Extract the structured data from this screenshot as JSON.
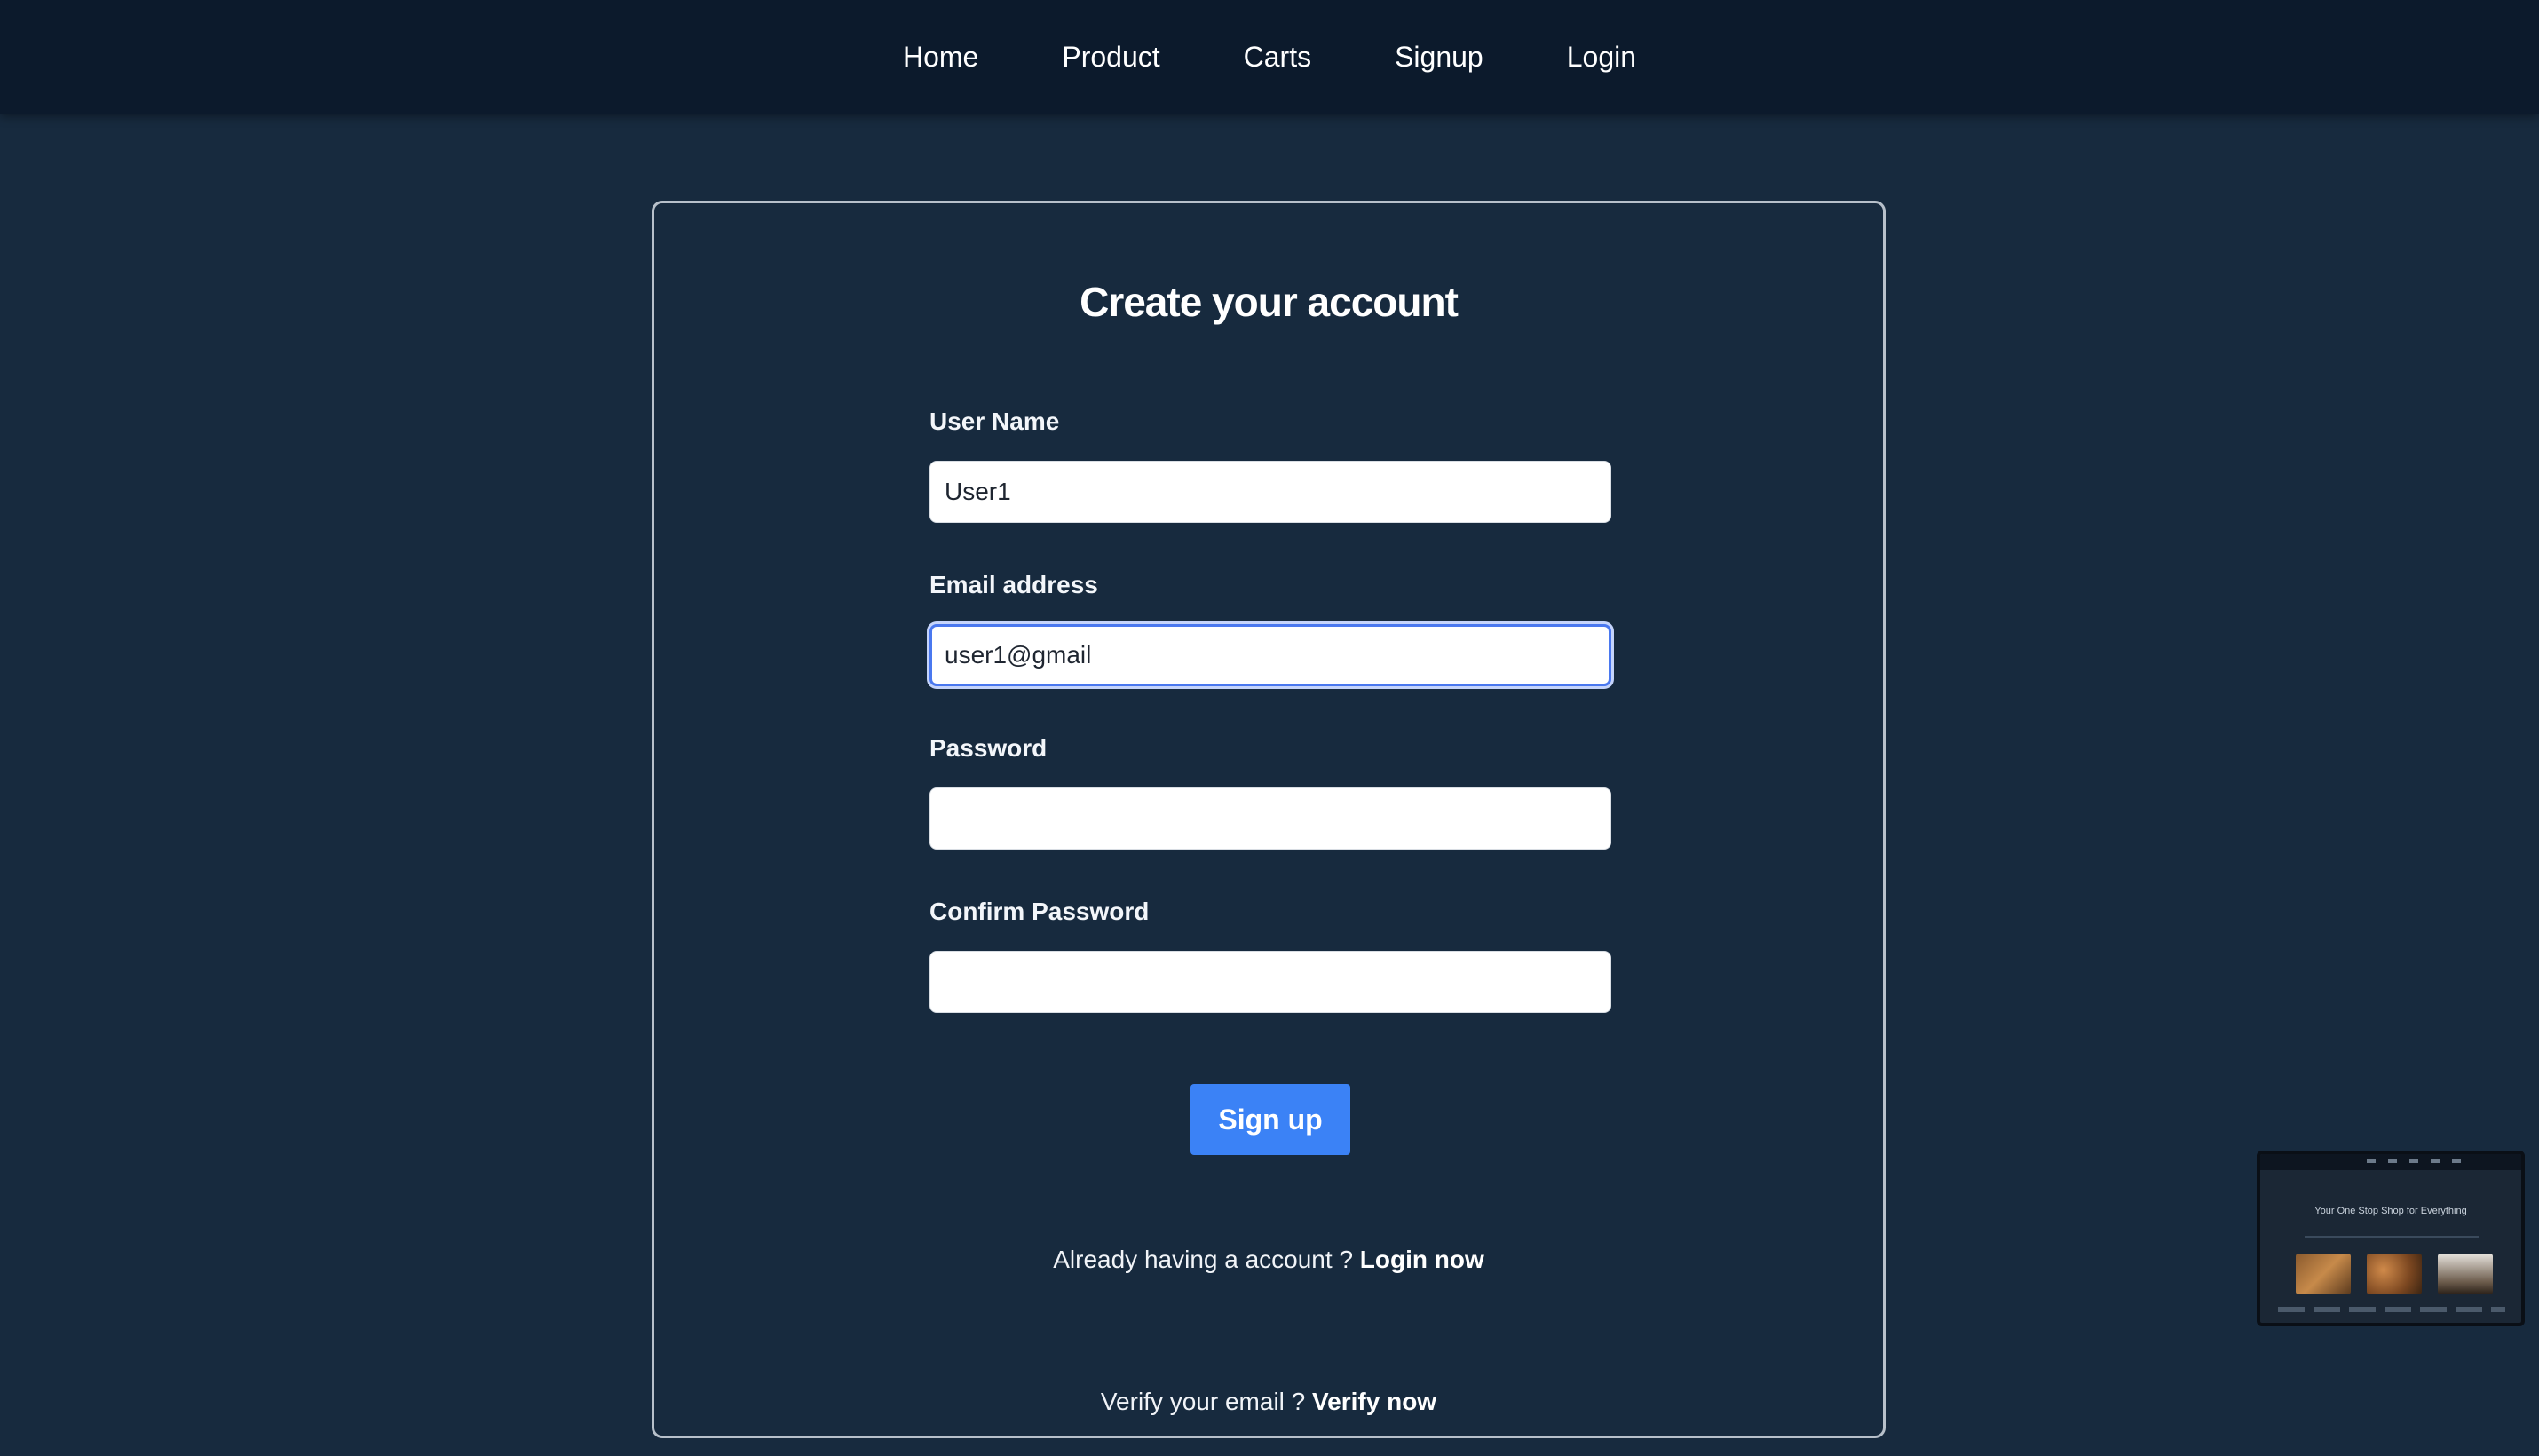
{
  "nav": {
    "items": [
      {
        "label": "Home"
      },
      {
        "label": "Product"
      },
      {
        "label": "Carts"
      },
      {
        "label": "Signup"
      },
      {
        "label": "Login"
      }
    ]
  },
  "form": {
    "title": "Create your account",
    "fields": {
      "username": {
        "label": "User Name",
        "value": "User1"
      },
      "email": {
        "label": "Email address",
        "value": "user1@gmail"
      },
      "password": {
        "label": "Password",
        "value": ""
      },
      "confirm_password": {
        "label": "Confirm Password",
        "value": ""
      }
    },
    "submit_label": "Sign up",
    "login_prompt": {
      "text": "Already having a account ? ",
      "link": "Login now"
    },
    "verify_prompt": {
      "text": "Verify your email ? ",
      "link": "Verify now"
    }
  },
  "thumbnail": {
    "tagline": "Your One Stop Shop for Everything"
  },
  "colors": {
    "background": "#172a3e",
    "navbar": "#0c1a2c",
    "accent": "#3b82f6",
    "focus_border": "#4a78ef"
  }
}
